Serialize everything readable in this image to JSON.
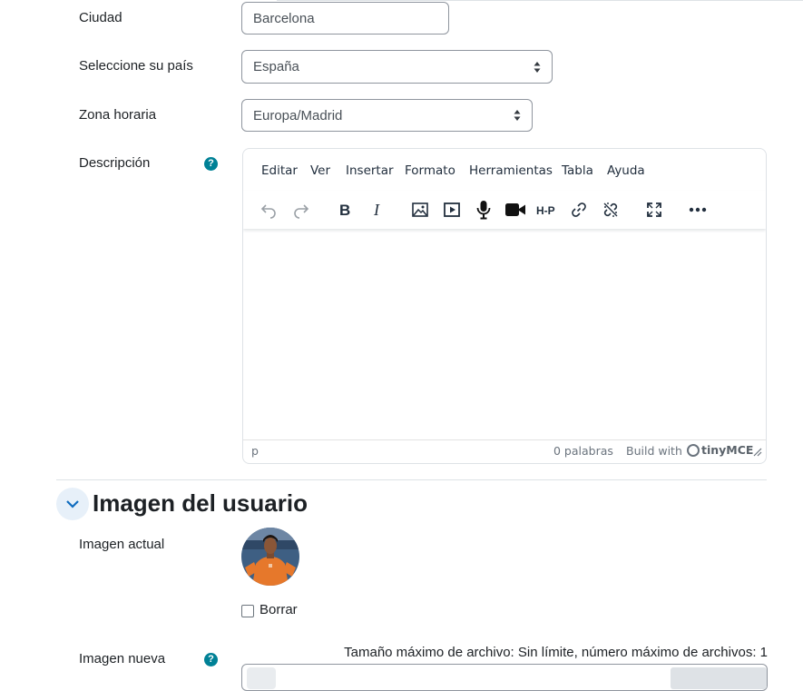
{
  "form": {
    "city": {
      "label": "Ciudad",
      "value": "Barcelona"
    },
    "country": {
      "label": "Seleccione su país",
      "value": "España"
    },
    "timezone": {
      "label": "Zona horaria",
      "value": "Europa/Madrid"
    },
    "description": {
      "label": "Descripción",
      "help_icon": "question-circle-icon"
    }
  },
  "editor": {
    "menus": [
      "Editar",
      "Ver",
      "Insertar",
      "Formato",
      "Herramientas",
      "Tabla",
      "Ayuda"
    ],
    "toolbar_icons": [
      "undo-icon",
      "redo-icon",
      "bold-icon",
      "italic-icon",
      "image-icon",
      "media-icon",
      "microphone-icon",
      "video-camera-icon",
      "h5p-icon",
      "link-icon",
      "unlink-icon",
      "fullscreen-icon",
      "more-icon"
    ],
    "h5p_label": "H-P",
    "status": {
      "path": "p",
      "word_count": "0 palabras",
      "branding_prefix": "Build with",
      "branding_name": "tinyMCE"
    }
  },
  "section": {
    "title": "Imagen del usuario",
    "current_image_label": "Imagen actual",
    "delete_label": "Borrar",
    "new_image_label": "Imagen nueva",
    "file_limits": "Tamaño máximo de archivo: Sin límite, número máximo de archivos: 1"
  },
  "colors": {
    "accent": "#0f6cbf",
    "help": "#008196",
    "text": "#1d2125",
    "border": "#8f959e"
  }
}
